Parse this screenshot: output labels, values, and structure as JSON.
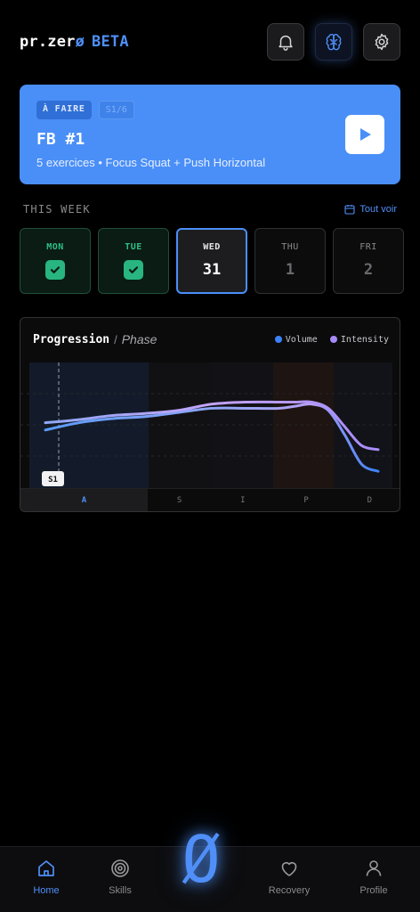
{
  "header": {
    "brand_prefix": "pr.zer",
    "brand_slash": "ø",
    "brand_badge": "BETA",
    "icons": [
      "bell-icon",
      "brain-icon",
      "gear-icon"
    ]
  },
  "workout_card": {
    "tag_status": "À FAIRE",
    "tag_session": "S1/6",
    "title": "FB #1",
    "subtitle": "5 exercices • Focus Squat + Push Horizontal",
    "play_icon": "play-icon",
    "color": "#4a8ff7"
  },
  "week": {
    "label": "THIS WEEK",
    "see_all": "Tout voir",
    "days": [
      {
        "name": "MON",
        "state": "done"
      },
      {
        "name": "TUE",
        "state": "done"
      },
      {
        "name": "WED",
        "num": "31",
        "state": "today"
      },
      {
        "name": "THU",
        "num": "1",
        "state": "future"
      },
      {
        "name": "FRI",
        "num": "2",
        "state": "future"
      }
    ]
  },
  "progression": {
    "title": "Progression",
    "separator": "/",
    "subtitle": "Phase",
    "marker": "S1",
    "legend": [
      {
        "name": "Volume",
        "color": "#3b82f6"
      },
      {
        "name": "Intensity",
        "color": "#a78bfa"
      }
    ],
    "phases": [
      "A",
      "S",
      "I",
      "P",
      "D"
    ],
    "active_phase": "A"
  },
  "chart_data": {
    "type": "line",
    "x": [
      0,
      0.1,
      0.2,
      0.3,
      0.4,
      0.5,
      0.6,
      0.7,
      0.75,
      0.8,
      0.85,
      0.9,
      0.95,
      1.0
    ],
    "series": [
      {
        "name": "Volume",
        "values": [
          0.45,
          0.52,
          0.56,
          0.58,
          0.62,
          0.66,
          0.66,
          0.66,
          0.68,
          0.7,
          0.64,
          0.4,
          0.12,
          0.05
        ]
      },
      {
        "name": "Intensity",
        "values": [
          0.52,
          0.55,
          0.59,
          0.61,
          0.64,
          0.7,
          0.72,
          0.72,
          0.72,
          0.72,
          0.66,
          0.48,
          0.3,
          0.26
        ]
      }
    ],
    "categories": [
      "A",
      "S",
      "I",
      "P",
      "D"
    ]
  },
  "nav": {
    "items": [
      {
        "label": "Home",
        "icon": "home-icon"
      },
      {
        "label": "Skills",
        "icon": "target-icon"
      },
      {
        "label": "Recovery",
        "icon": "heart-icon"
      },
      {
        "label": "Profile",
        "icon": "user-icon"
      }
    ],
    "center_logo": "Ø"
  }
}
